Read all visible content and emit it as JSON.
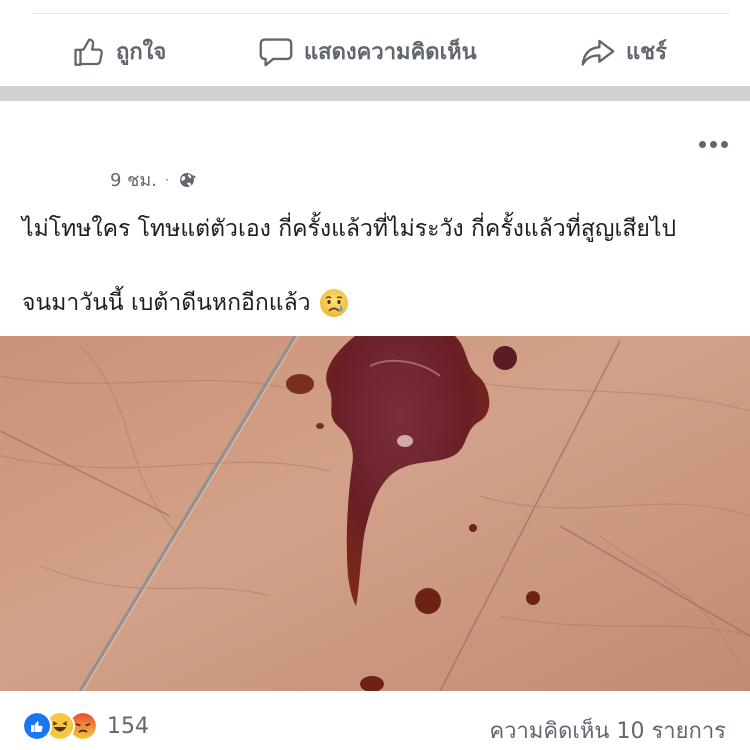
{
  "actions": {
    "like_label": "ถูกใจ",
    "comment_label": "แสดงความคิดเห็น",
    "share_label": "แชร์"
  },
  "post": {
    "time": "9 ชม.",
    "separator": "·",
    "privacy_icon": "globe-icon",
    "text_line1": "ไม่โทษใคร โทษแต่ตัวเอง กี่ครั้งแล้วที่ไม่ระวัง กี่ครั้งแล้วที่สูญเสียไป",
    "text_line2": "จนมาวันนี้ เบต้าดีนหกอีกแล้ว",
    "emoji": "crying-face"
  },
  "footer": {
    "reaction_icons": [
      "like",
      "haha",
      "angry"
    ],
    "reaction_count": "154",
    "comments_label": "ความคิดเห็น 10 รายการ"
  },
  "colors": {
    "muted_text": "#606770",
    "like_blue": "#1877f2",
    "band_gray": "#cfd0d4"
  }
}
